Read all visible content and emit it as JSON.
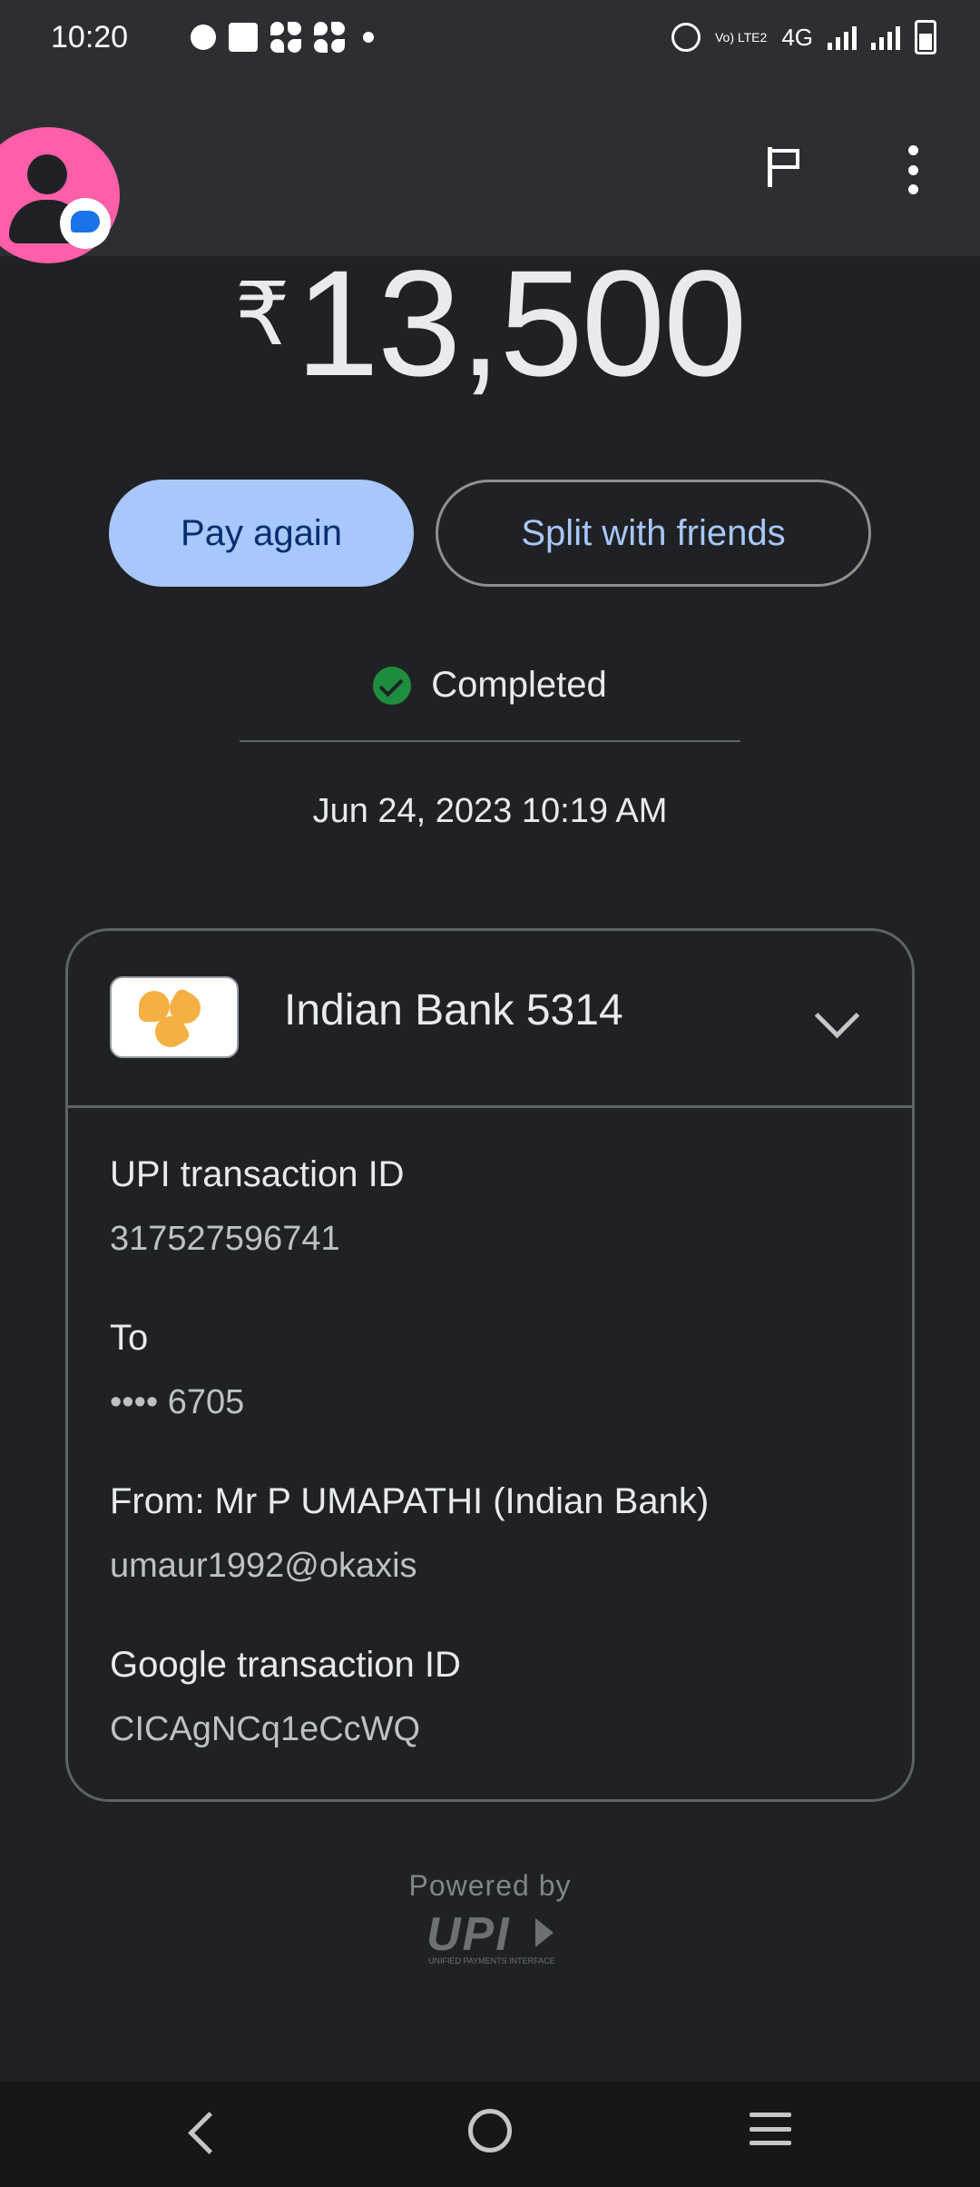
{
  "status_bar": {
    "time": "10:20",
    "network": "4G",
    "volte": "Vo) LTE2"
  },
  "top_bar": {
    "avatar_color": "#ff5fa8",
    "icons": [
      "flag-icon",
      "more-vert-icon"
    ]
  },
  "transaction": {
    "currency_symbol": "₹",
    "amount": "13,500",
    "status": "Completed",
    "datetime": "Jun 24, 2023 10:19 AM"
  },
  "actions": {
    "pay_again": "Pay again",
    "split": "Split with friends"
  },
  "account": {
    "bank_name": "Indian Bank 5314",
    "fields": [
      {
        "label": "UPI transaction ID",
        "value": "317527596741"
      },
      {
        "label": "To",
        "value": "•••• 6705"
      },
      {
        "label": "From: Mr P UMAPATHI (Indian Bank)",
        "value": "umaur1992@okaxis"
      },
      {
        "label": "Google transaction ID",
        "value": "CICAgNCq1eCcWQ"
      }
    ]
  },
  "footer": {
    "powered_by": "Powered by",
    "upi_logo": "UPI",
    "upi_sub": "UNIFIED PAYMENTS INTERFACE"
  },
  "colors": {
    "background": "#202124",
    "primary_button": "#a8c7fa",
    "success": "#1e8e3e",
    "bank_logo": "#f4b042"
  }
}
